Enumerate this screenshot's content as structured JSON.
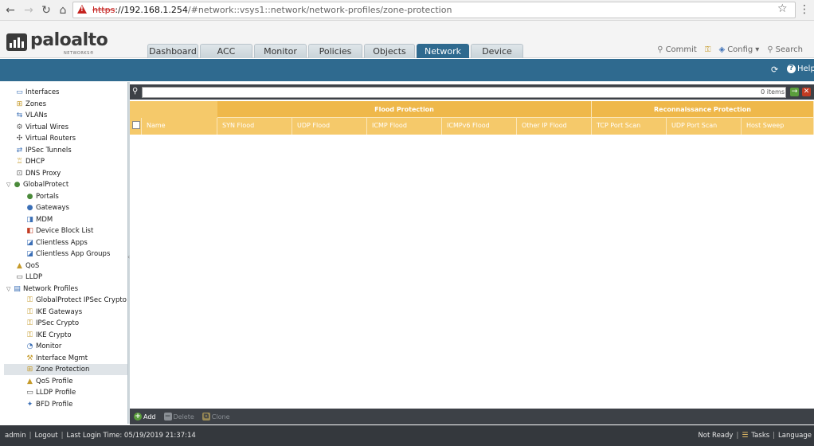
{
  "browser": {
    "url_proto": "https",
    "url_host": "://192.168.1.254",
    "url_path": "/#network::vsys1::network/network-profiles/zone-protection"
  },
  "logo": {
    "text": "paloalto",
    "sub": "NETWORKS®"
  },
  "tabs": [
    {
      "label": "Dashboard",
      "active": false
    },
    {
      "label": "ACC",
      "active": false
    },
    {
      "label": "Monitor",
      "active": false
    },
    {
      "label": "Policies",
      "active": false
    },
    {
      "label": "Objects",
      "active": false
    },
    {
      "label": "Network",
      "active": true
    },
    {
      "label": "Device",
      "active": false
    }
  ],
  "header_actions": {
    "commit": "Commit",
    "config": "Config",
    "search": "Search"
  },
  "toolbar": {
    "help": "Help"
  },
  "sidebar": {
    "items": [
      {
        "label": "Interfaces",
        "icon": "interfaces-icon",
        "glyph": "▭",
        "color": "#3b6fb6"
      },
      {
        "label": "Zones",
        "icon": "zones-icon",
        "glyph": "⊞",
        "color": "#c59a2a"
      },
      {
        "label": "VLANs",
        "icon": "vlans-icon",
        "glyph": "⇆",
        "color": "#3b6fb6"
      },
      {
        "label": "Virtual Wires",
        "icon": "virtual-wires-icon",
        "glyph": "⚙",
        "color": "#555555"
      },
      {
        "label": "Virtual Routers",
        "icon": "virtual-routers-icon",
        "glyph": "✣",
        "color": "#555555"
      },
      {
        "label": "IPSec Tunnels",
        "icon": "ipsec-tunnels-icon",
        "glyph": "⇄",
        "color": "#3b6fb6"
      },
      {
        "label": "DHCP",
        "icon": "dhcp-icon",
        "glyph": "♖",
        "color": "#c59a2a"
      },
      {
        "label": "DNS Proxy",
        "icon": "dns-proxy-icon",
        "glyph": "⊡",
        "color": "#555555"
      },
      {
        "label": "GlobalProtect",
        "icon": "globalprotect-icon",
        "glyph": "●",
        "color": "#4a8a3a"
      },
      {
        "label": "Portals",
        "icon": "portals-icon",
        "glyph": "●",
        "color": "#4a8a3a"
      },
      {
        "label": "Gateways",
        "icon": "gateways-icon",
        "glyph": "●",
        "color": "#3b6fb6"
      },
      {
        "label": "MDM",
        "icon": "mdm-icon",
        "glyph": "◨",
        "color": "#3b6fb6"
      },
      {
        "label": "Device Block List",
        "icon": "device-block-list-icon",
        "glyph": "◧",
        "color": "#c23b22"
      },
      {
        "label": "Clientless Apps",
        "icon": "clientless-apps-icon",
        "glyph": "◪",
        "color": "#3b6fb6"
      },
      {
        "label": "Clientless App Groups",
        "icon": "clientless-app-groups-icon",
        "glyph": "◪",
        "color": "#3b6fb6"
      },
      {
        "label": "QoS",
        "icon": "qos-icon",
        "glyph": "▲",
        "color": "#c59a2a"
      },
      {
        "label": "LLDP",
        "icon": "lldp-icon",
        "glyph": "▭",
        "color": "#555555"
      },
      {
        "label": "Network Profiles",
        "icon": "network-profiles-icon",
        "glyph": "▤",
        "color": "#3b6fb6"
      },
      {
        "label": "GlobalProtect IPSec Crypto",
        "icon": "gp-ipsec-crypto-icon",
        "glyph": "⚿",
        "color": "#c59a2a"
      },
      {
        "label": "IKE Gateways",
        "icon": "ike-gateways-icon",
        "glyph": "⚿",
        "color": "#c59a2a"
      },
      {
        "label": "IPSec Crypto",
        "icon": "ipsec-crypto-icon",
        "glyph": "⚿",
        "color": "#c59a2a"
      },
      {
        "label": "IKE Crypto",
        "icon": "ike-crypto-icon",
        "glyph": "⚿",
        "color": "#c59a2a"
      },
      {
        "label": "Monitor",
        "icon": "monitor-icon",
        "glyph": "◔",
        "color": "#3b6fb6"
      },
      {
        "label": "Interface Mgmt",
        "icon": "interface-mgmt-icon",
        "glyph": "⚒",
        "color": "#c59a2a"
      },
      {
        "label": "Zone Protection",
        "icon": "zone-protection-icon",
        "glyph": "⊞",
        "color": "#c59a2a"
      },
      {
        "label": "QoS Profile",
        "icon": "qos-profile-icon",
        "glyph": "▲",
        "color": "#c59a2a"
      },
      {
        "label": "LLDP Profile",
        "icon": "lldp-profile-icon",
        "glyph": "▭",
        "color": "#555555"
      },
      {
        "label": "BFD Profile",
        "icon": "bfd-profile-icon",
        "glyph": "✦",
        "color": "#3b6fb6"
      }
    ]
  },
  "filter": {
    "count": "0 items"
  },
  "grid": {
    "groups": [
      "Flood Protection",
      "Reconnaissance Protection"
    ],
    "columns": [
      "Name",
      "SYN Flood",
      "UDP Flood",
      "ICMP Flood",
      "ICMPv6 Flood",
      "Other IP Flood",
      "TCP Port Scan",
      "UDP Port Scan",
      "Host Sweep"
    ]
  },
  "actions": {
    "add": "Add",
    "delete": "Delete",
    "clone": "Clone"
  },
  "status": {
    "user": "admin",
    "logout": "Logout",
    "last_login": "Last Login Time: 05/19/2019 21:37:14",
    "ready": "Not Ready",
    "tasks": "Tasks",
    "language": "Language"
  },
  "colors": {
    "accent_blue": "#2f6a8f",
    "header_gold": "#f5c96a",
    "group_gold": "#efb84a",
    "dark_bar": "#3d4147"
  }
}
